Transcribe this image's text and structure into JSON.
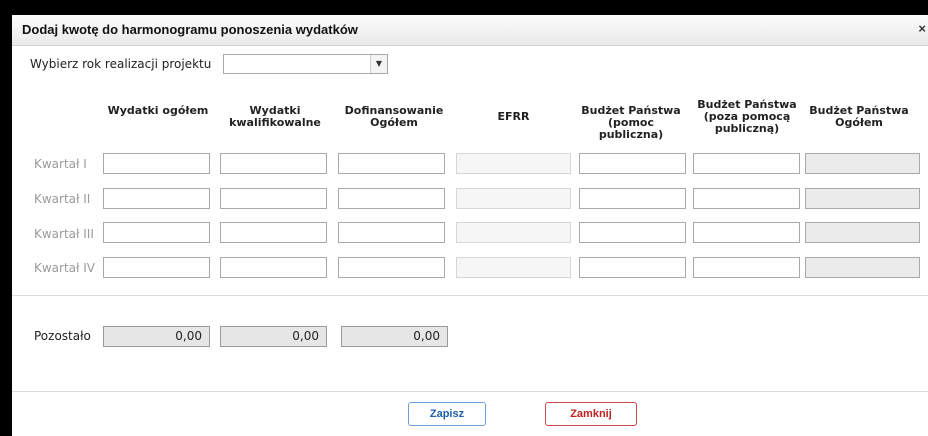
{
  "dialog": {
    "title": "Dodaj kwotę do harmonogramu ponoszenia wydatków",
    "close_symbol": "×"
  },
  "year": {
    "label": "Wybierz rok realizacji projektu",
    "selected": "",
    "arrow": "▼"
  },
  "columns": [
    "Wydatki ogółem",
    "Wydatki kwalifikowalne",
    "Dofinansowanie Ogółem",
    "EFRR",
    "Budżet Państwa (pomoc publiczna)",
    "Budżet Państwa (poza pomocą publiczną)",
    "Budżet Państwa Ogółem"
  ],
  "rows": [
    "Kwartał I",
    "Kwartał II",
    "Kwartał III",
    "Kwartał IV"
  ],
  "remaining": {
    "label": "Pozostało",
    "values": [
      "0,00",
      "0,00",
      "0,00"
    ]
  },
  "buttons": {
    "save": "Zapisz",
    "close": "Zamknij"
  }
}
